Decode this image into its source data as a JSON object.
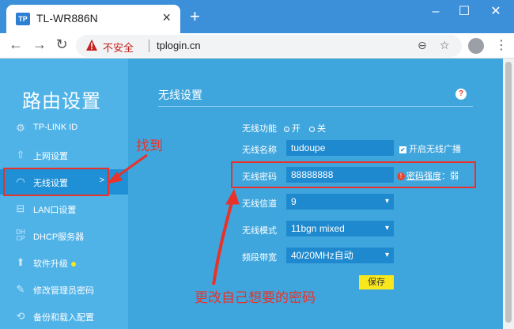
{
  "browser": {
    "tab_title": "TL-WR886N",
    "tab_favicon": "TP",
    "insecure_label": "不安全",
    "url": "tplogin.cn",
    "colors": {
      "tabbar": "#3c8fd9",
      "insecure": "#c5221f"
    }
  },
  "sidebar": {
    "title": "路由设置",
    "items": [
      {
        "label": "TP-LINK ID",
        "icon": "tplink-id-icon"
      },
      {
        "label": "上网设置",
        "icon": "upload-icon"
      },
      {
        "label": "无线设置",
        "icon": "wifi-icon",
        "active": true,
        "arrow": ">"
      },
      {
        "label": "LAN口设置",
        "icon": "lan-icon"
      },
      {
        "label": "DHCP服务器",
        "icon": "dhcp-icon"
      },
      {
        "label": "软件升级",
        "icon": "upgrade-icon",
        "badge": true
      },
      {
        "label": "修改管理员密码",
        "icon": "edit-icon"
      },
      {
        "label": "备份和载入配置",
        "icon": "backup-icon"
      }
    ]
  },
  "content": {
    "title": "无线设置",
    "help": "?",
    "wireless_function": {
      "label": "无线功能",
      "on_label": "开",
      "off_label": "关",
      "value": "开"
    },
    "ssid": {
      "label": "无线名称",
      "value": "tudoupe",
      "broadcast_label": "开启无线广播",
      "broadcast": true
    },
    "password": {
      "label": "无线密码",
      "value": "88888888",
      "strength_label": "密码强度",
      "strength_value": "：弱"
    },
    "channel": {
      "label": "无线信道",
      "value": "9"
    },
    "mode": {
      "label": "无线模式",
      "value": "11bgn mixed"
    },
    "bandwidth": {
      "label": "频段带宽",
      "value": "40/20MHz自动"
    },
    "save_label": "保存"
  },
  "annotations": {
    "find": "找到",
    "change": "更改自己想要的密码",
    "color": "#e8322a"
  }
}
